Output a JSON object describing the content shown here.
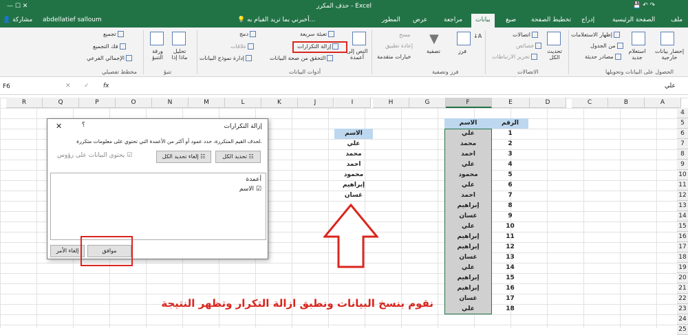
{
  "title": "حذف المكرر - Excel",
  "user": "abdellatief salloum",
  "share": "مشاركة",
  "tell_me": "أخبرني بما تريد القيام به...",
  "tabs": [
    "ملف",
    "الصفحة الرئيسية",
    "إدراج",
    "تخطيط الصفحة",
    "صيغ",
    "بيانات",
    "مراجعة",
    "عرض",
    "المطور"
  ],
  "ribbon": {
    "get_external": "إحضار بيانات خارجية",
    "new_query": "استعلام جديد",
    "show_queries": "إظهار الاستعلامات",
    "from_table": "من الجدول",
    "recent_sources": "مصادر حديثة",
    "refresh_all": "تحديث الكل",
    "connections": "اتصالات",
    "properties": "خصائص",
    "edit_links": "تحرير الارتباطات",
    "sort": "فرز",
    "filter": "تصفية",
    "clear": "مسح",
    "reapply": "إعادة تطبيق",
    "advanced": "خيارات متقدمة",
    "text_to_columns": "النص إلى أعمدة",
    "flash_fill": "تعبئة سريعة",
    "remove_duplicates": "إزالة التكرارات",
    "data_validation": "التحقق من صحة البيانات",
    "consolidate": "دمج",
    "relationships": "علاقات",
    "manage_model": "إدارة نموذج البيانات",
    "what_if": "تحليل ماذا إذا",
    "forecast_sheet": "ورقة التنبؤ",
    "group": "تجميع",
    "ungroup": "فك التجميع",
    "subtotal": "الإجمالي الفرعي",
    "g_get_transform": "الحصول على البيانات وتحويلها",
    "g_connections": "الاتصالات",
    "g_sort_filter": "فرز وتصفية",
    "g_data_tools": "أدوات البيانات",
    "g_forecast": "تنبؤ",
    "g_outline": "مخطط تفصيلي"
  },
  "formula_bar": {
    "name_box": "F6",
    "fx": "fx",
    "value": "علي"
  },
  "columns": [
    "A",
    "B",
    "C",
    "D",
    "E",
    "F",
    "G",
    "H",
    "I",
    "J",
    "K",
    "L",
    "M",
    "N",
    "O",
    "P",
    "Q",
    "R"
  ],
  "rows": [
    "4",
    "5",
    "6",
    "7",
    "8",
    "9",
    "10",
    "11",
    "12",
    "13",
    "14",
    "15",
    "16",
    "17",
    "18",
    "19",
    "20",
    "21",
    "22",
    "23",
    "24",
    "25"
  ],
  "table": {
    "header_num": "الرقم",
    "header_name": "الاسم",
    "nums": [
      "1",
      "2",
      "3",
      "4",
      "5",
      "6",
      "7",
      "8",
      "9",
      "10",
      "11",
      "12",
      "13",
      "14",
      "15",
      "16",
      "17",
      "18"
    ],
    "names": [
      "علي",
      "محمد",
      "احمد",
      "علي",
      "محمود",
      "علي",
      "احمد",
      "إبراهيم",
      "غسان",
      "علي",
      "إبراهيم",
      "إبراهيم",
      "غسان",
      "علي",
      "إبراهيم",
      "إبراهيم",
      "غسان",
      "علي"
    ]
  },
  "result": {
    "header": "الاسم",
    "names": [
      "علي",
      "محمد",
      "احمد",
      "محمود",
      "إبراهيم",
      "غسان"
    ]
  },
  "dialog": {
    "title": "إزالة التكرارات",
    "help": "؟",
    "close": "✕",
    "instruction": "لحذف القيم المتكررة، حدد عمود أو أكثر من الأعمدة التي تحتوي على معلومات متكررة.",
    "select_all": "تحديد الكل",
    "unselect_all": "إلغاء تحديد الكل",
    "has_headers": "يحتوي البيانات على رؤوس",
    "columns_label": "أعمدة",
    "column_item": "الاسم",
    "ok": "موافق",
    "cancel": "إلغاء الأمر"
  },
  "annotation": "نقوم بنسخ البيانات ونطبق ازالة التكرار وتظهر النتيجة",
  "colors": {
    "excel_green": "#217346",
    "red": "#d9251d",
    "header_blue": "#bdd7ee"
  }
}
